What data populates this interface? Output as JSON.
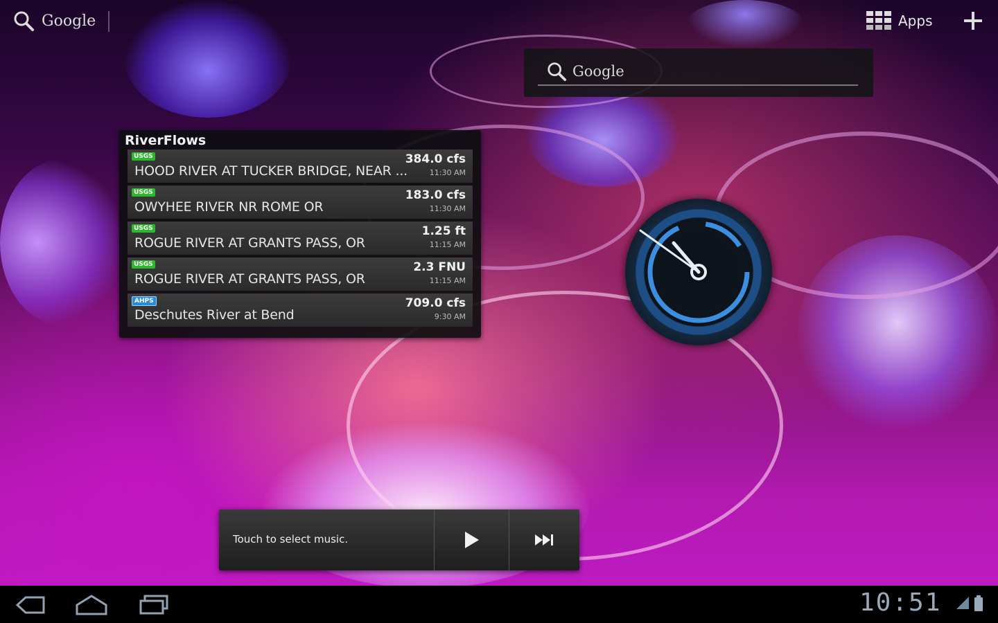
{
  "topbar": {
    "search_label": "Google",
    "apps_label": "Apps"
  },
  "google_widget": {
    "label": "Google"
  },
  "riverflows": {
    "title": "RiverFlows",
    "rows": [
      {
        "badge": "USGS",
        "name": "HOOD RIVER AT TUCKER BRIDGE, NEAR ...",
        "value": "384.0 cfs",
        "time": "11:30 AM"
      },
      {
        "badge": "USGS",
        "name": "OWYHEE RIVER NR ROME OR",
        "value": "183.0 cfs",
        "time": "11:30 AM"
      },
      {
        "badge": "USGS",
        "name": "ROGUE RIVER AT GRANTS PASS, OR",
        "value": "1.25 ft",
        "time": "11:15 AM"
      },
      {
        "badge": "USGS",
        "name": "ROGUE RIVER AT GRANTS PASS, OR",
        "value": "2.3 FNU",
        "time": "11:15 AM"
      },
      {
        "badge": "AHPS",
        "name": "Deschutes River at Bend",
        "value": "709.0 cfs",
        "time": "9:30 AM"
      }
    ]
  },
  "music": {
    "label": "Touch to select music."
  },
  "system_bar": {
    "time": "10:51"
  },
  "colors": {
    "usgs": "#2fb82f",
    "ahps": "#2a8bd8",
    "clock_accent": "#3c8fe0"
  }
}
